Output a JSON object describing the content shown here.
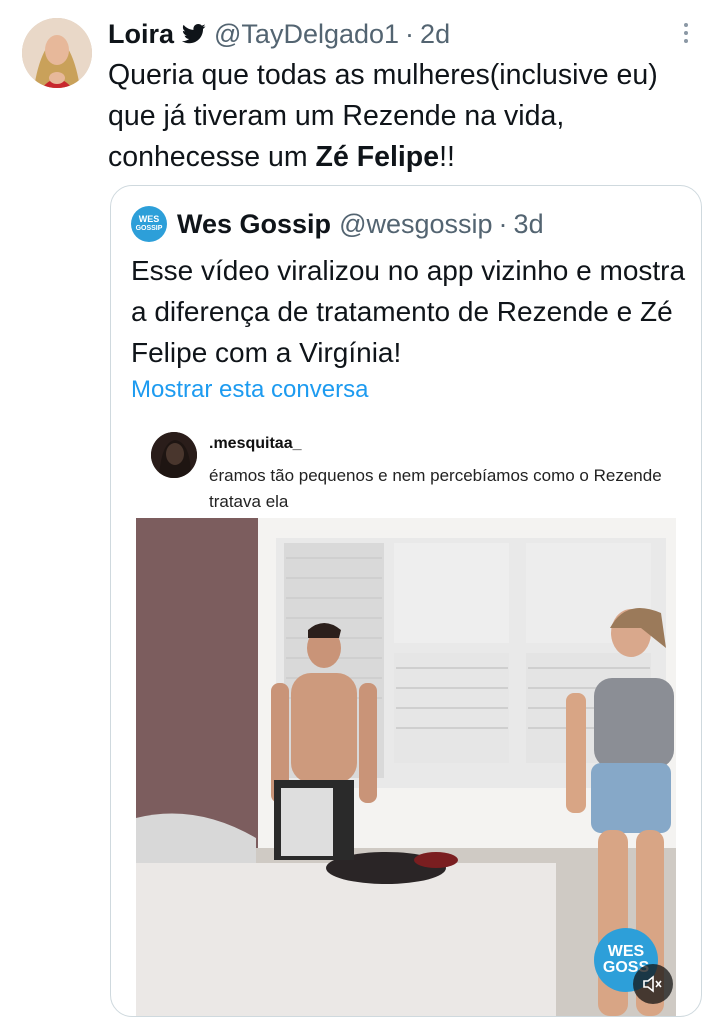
{
  "tweet": {
    "display_name": "Loira",
    "handle": "@TayDelgado1",
    "separator": "·",
    "time": "2d",
    "text_part1": "Queria que todas as mulheres(inclusive eu) que já tiveram um Rezende na vida, conhecesse um ",
    "text_bold": "Zé Felipe",
    "text_part2": "!!"
  },
  "quoted_tweet": {
    "avatar_text_line1": "WES",
    "avatar_text_line2": "GOSSIP",
    "display_name": "Wes Gossip",
    "handle": "@wesgossip",
    "separator": "·",
    "time": "3d",
    "text": "Esse vídeo viralizou no app vizinho e mostra a diferença de tratamento de Rezende e Zé Felipe com a Virgínia!",
    "show_thread": "Mostrar esta conversa"
  },
  "media": {
    "username": ".mesquitaa_",
    "caption": "éramos tão pequenos e nem percebíamos como o Rezende tratava ela",
    "watermark_line1": "WES",
    "watermark_line2": "GOSS"
  },
  "colors": {
    "link": "#1d9bf0",
    "muted": "#536471",
    "border": "#cfd9de",
    "brand": "#2d9fd9"
  },
  "icons": [
    "twitter-bird-icon",
    "more-icon",
    "volume-icon"
  ]
}
